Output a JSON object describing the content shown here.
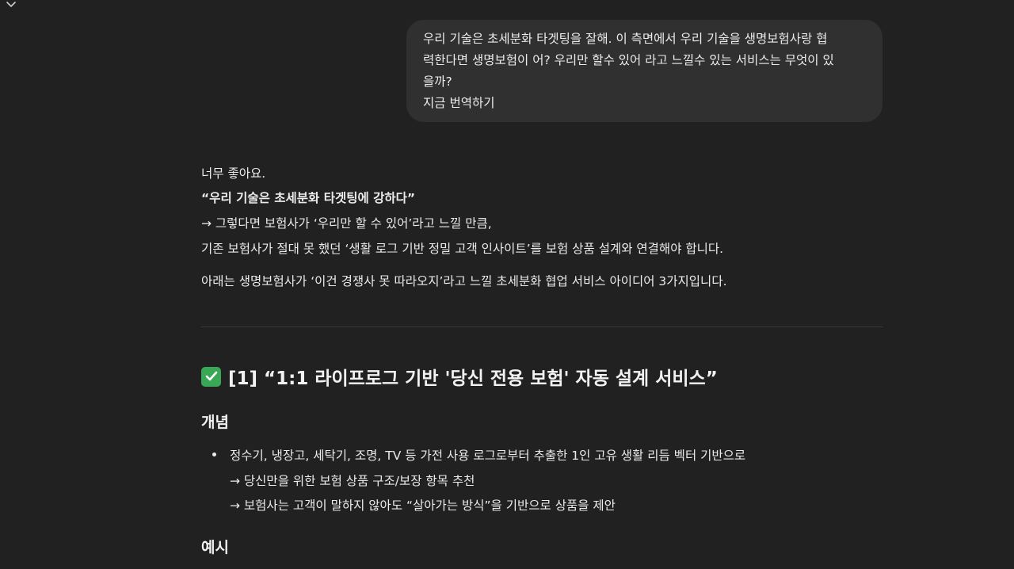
{
  "user_message": {
    "lines": [
      "우리 기술은 초세분화 타겟팅을 잘해. 이 측면에서 우리 기술을 생명보험사랑 협",
      "력한다면 생명보험이 어? 우리만 할수 있어 라고 느낄수 있는 서비스는 무엇이 있",
      "을까?",
      "지금 번역하기"
    ]
  },
  "assistant": {
    "intro": "너무 좋아요.",
    "quote": "“우리 기술은 초세분화 타겟팅에 강하다”",
    "arrow_line": "→ 그렇다면 보험사가 ‘우리만 할 수 있어’라고 느낄 만큼,",
    "connect_line": "기존 보험사가 절대 못 했던 ‘생활 로그 기반 정밀 고객 인사이트’를 보험 상품 설계와 연결해야 합니다.",
    "summary_line": "아래는 생명보험사가 ‘이건 경쟁사 못 따라오지’라고 느낄 초세분화 협업 서비스 아이디어 3가지입니다.",
    "section1": {
      "title": "[1] “1:1 라이프로그 기반 '당신 전용 보험' 자동 설계 서비스”",
      "concept_heading": "개념",
      "bullet": "정수기, 냉장고, 세탁기, 조명, TV 등 가전 사용 로그로부터 추출한 1인 고유 생활 리듬 벡터 기반으로",
      "sub1": "→ 당신만을 위한 보험 상품 구조/보장 항목 추천",
      "sub2": "→ 보험사는 고객이 말하지 않아도 “살아가는 방식”을 기반으로 상품을 제안",
      "example_heading": "예시"
    }
  }
}
